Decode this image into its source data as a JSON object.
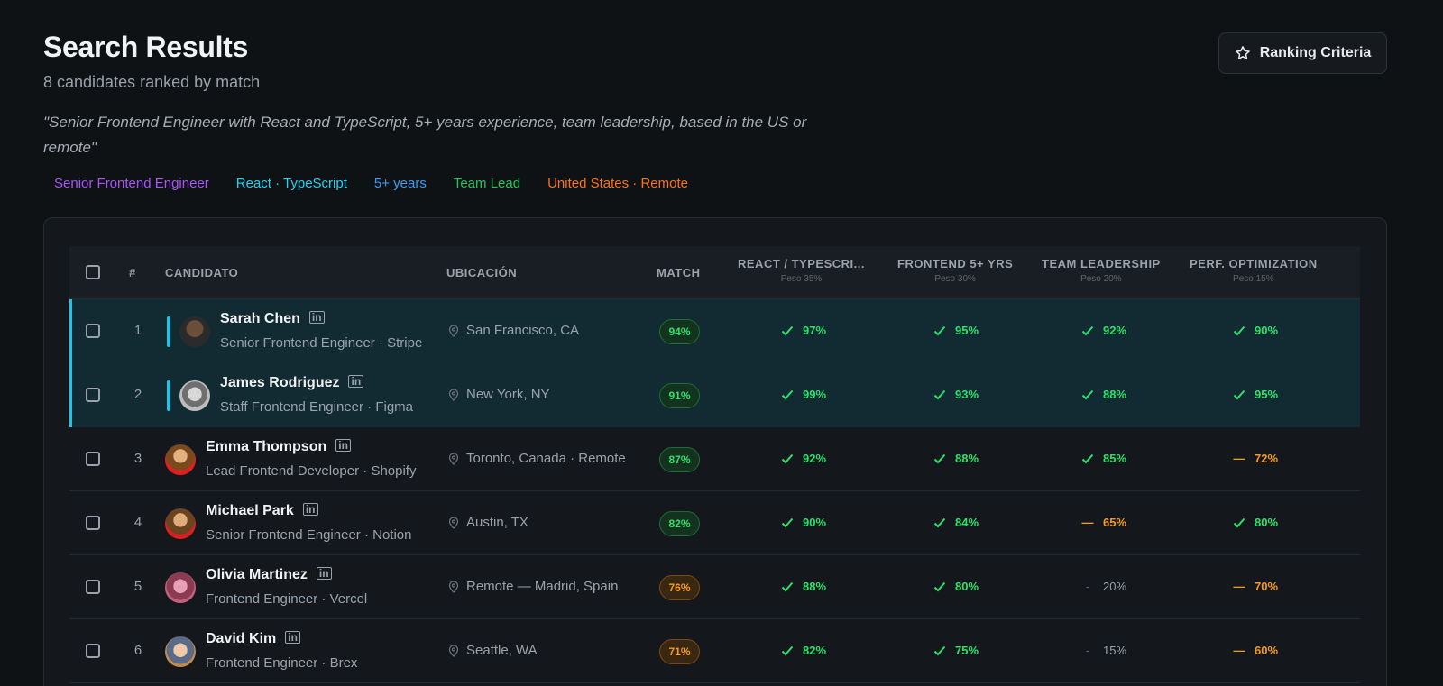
{
  "header": {
    "title": "Search Results",
    "subtitle": "8 candidates ranked by match",
    "query": "\"Senior Frontend Engineer with React and TypeScript, 5+ years experience, team leadership, based in the US or remote\"",
    "ranking_button": "Ranking Criteria"
  },
  "tags": [
    {
      "label": "Senior Frontend Engineer",
      "color": "#a855f7"
    },
    {
      "label": "React · TypeScript",
      "color": "#22d3ee"
    },
    {
      "label": "5+ years",
      "color": "#3b9cf5"
    },
    {
      "label": "Team Lead",
      "color": "#22c55e"
    },
    {
      "label": "United States · Remote",
      "color": "#f97316"
    }
  ],
  "table": {
    "headers": {
      "index": "#",
      "candidate": "CANDIDATO",
      "location": "UBICACIÓN",
      "match": "MATCH",
      "c1": "REACT / TYPESCRI...",
      "c1_weight": "Peso 35%",
      "c2": "FRONTEND 5+ YRS",
      "c2_weight": "Peso 30%",
      "c3": "TEAM LEADERSHIP",
      "c3_weight": "Peso 20%",
      "c4": "PERF. OPTIMIZATION",
      "c4_weight": "Peso 15%"
    },
    "rows": [
      {
        "rank": "1",
        "name": "Sarah Chen",
        "role": "Senior Frontend Engineer · Stripe",
        "location": "San Francisco, CA",
        "match": "94%",
        "match_level": "green",
        "highlight": true,
        "scores": [
          {
            "v": "97%",
            "s": "green"
          },
          {
            "v": "95%",
            "s": "green"
          },
          {
            "v": "92%",
            "s": "green"
          },
          {
            "v": "90%",
            "s": "green"
          }
        ]
      },
      {
        "rank": "2",
        "name": "James Rodriguez",
        "role": "Staff Frontend Engineer · Figma",
        "location": "New York, NY",
        "match": "91%",
        "match_level": "green",
        "highlight": true,
        "scores": [
          {
            "v": "99%",
            "s": "green"
          },
          {
            "v": "93%",
            "s": "green"
          },
          {
            "v": "88%",
            "s": "green"
          },
          {
            "v": "95%",
            "s": "green"
          }
        ]
      },
      {
        "rank": "3",
        "name": "Emma Thompson",
        "role": "Lead Frontend Developer · Shopify",
        "location": "Toronto, Canada · Remote",
        "match": "87%",
        "match_level": "green",
        "highlight": false,
        "scores": [
          {
            "v": "92%",
            "s": "green"
          },
          {
            "v": "88%",
            "s": "green"
          },
          {
            "v": "85%",
            "s": "green"
          },
          {
            "v": "72%",
            "s": "orange"
          }
        ]
      },
      {
        "rank": "4",
        "name": "Michael Park",
        "role": "Senior Frontend Engineer · Notion",
        "location": "Austin, TX",
        "match": "82%",
        "match_level": "green",
        "highlight": false,
        "scores": [
          {
            "v": "90%",
            "s": "green"
          },
          {
            "v": "84%",
            "s": "green"
          },
          {
            "v": "65%",
            "s": "orange"
          },
          {
            "v": "80%",
            "s": "green"
          }
        ]
      },
      {
        "rank": "5",
        "name": "Olivia Martinez",
        "role": "Frontend Engineer · Vercel",
        "location": "Remote — Madrid, Spain",
        "match": "76%",
        "match_level": "orange",
        "highlight": false,
        "scores": [
          {
            "v": "88%",
            "s": "green"
          },
          {
            "v": "80%",
            "s": "green"
          },
          {
            "v": "20%",
            "s": "gray"
          },
          {
            "v": "70%",
            "s": "orange"
          }
        ]
      },
      {
        "rank": "6",
        "name": "David Kim",
        "role": "Frontend Engineer · Brex",
        "location": "Seattle, WA",
        "match": "71%",
        "match_level": "orange",
        "highlight": false,
        "scores": [
          {
            "v": "82%",
            "s": "green"
          },
          {
            "v": "75%",
            "s": "green"
          },
          {
            "v": "15%",
            "s": "gray"
          },
          {
            "v": "60%",
            "s": "orange"
          }
        ]
      }
    ]
  }
}
